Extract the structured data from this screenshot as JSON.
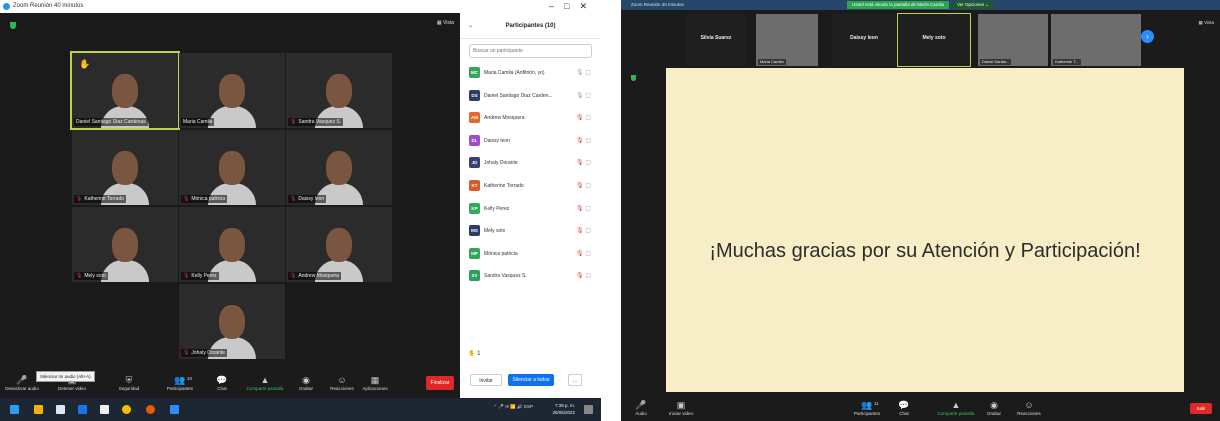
{
  "left": {
    "window_title": "Zoom Reunión 40 minutos",
    "window_controls": [
      "–",
      "□",
      "✕"
    ],
    "view_label": "Vista",
    "tiles": [
      {
        "name": "Daniel Santiago Diaz Cardenas",
        "muted": false,
        "hand": true,
        "active": true
      },
      {
        "name": "Maria Camila",
        "muted": false,
        "hand": false,
        "active": false
      },
      {
        "name": "Sandra Vasquez S.",
        "muted": true,
        "hand": false,
        "active": false
      },
      {
        "name": "Katherine Torrado",
        "muted": true,
        "hand": false,
        "active": false
      },
      {
        "name": "Mónica patricia",
        "muted": true,
        "hand": false,
        "active": false
      },
      {
        "name": "Daissy leon",
        "muted": true,
        "hand": false,
        "active": false
      },
      {
        "name": "Mely soto",
        "muted": true,
        "hand": false,
        "active": false
      },
      {
        "name": "Kelly Perez",
        "muted": true,
        "hand": false,
        "active": false
      },
      {
        "name": "Andrew Mosquera",
        "muted": true,
        "hand": false,
        "active": false
      },
      {
        "name": "Johaly Dorante",
        "muted": true,
        "hand": false,
        "active": false
      }
    ],
    "tooltip": "Silenciar mi audio (Alt+A)",
    "toolbar": [
      {
        "label": "Desactivar audio",
        "icon": "🎤"
      },
      {
        "label": "Detener video",
        "icon": "▣"
      },
      {
        "label": "Seguridad",
        "icon": "⛨"
      },
      {
        "label": "Participantes",
        "icon": "👥",
        "count": "10"
      },
      {
        "label": "Chat",
        "icon": "💬"
      },
      {
        "label": "Compartir pantalla",
        "icon": "▲"
      },
      {
        "label": "Grabar",
        "icon": "◉"
      },
      {
        "label": "Reacciones",
        "icon": "☺"
      },
      {
        "label": "Aplicaciones",
        "icon": "▦"
      }
    ],
    "end_label": "Finalizar",
    "panel": {
      "title": "Participantes (10)",
      "search_placeholder": "Buscar un participante",
      "participants": [
        {
          "initials": "MC",
          "name": "Maria Camila (Anfitrión, yo)",
          "color": "#3aa35b",
          "muted": false
        },
        {
          "initials": "DS",
          "name": "Daniel Santiago Diaz Carden...",
          "color": "#2c3e63",
          "muted": false
        },
        {
          "initials": "AM",
          "name": "Andrew Mosquera",
          "color": "#e0692b",
          "muted": true
        },
        {
          "initials": "DL",
          "name": "Daissy leon",
          "color": "#9a4fc8",
          "muted": true
        },
        {
          "initials": "JD",
          "name": "Johaly Dorante",
          "color": "#3a3f73",
          "muted": true
        },
        {
          "initials": "KT",
          "name": "Katherine Torrado",
          "color": "#d65a2a",
          "muted": true
        },
        {
          "initials": "KP",
          "name": "Kelly Perez",
          "color": "#36a85a",
          "muted": true
        },
        {
          "initials": "MS",
          "name": "Mely soto",
          "color": "#2f3b66",
          "muted": true
        },
        {
          "initials": "MP",
          "name": "Mónica patricia",
          "color": "#3aa35b",
          "muted": true
        },
        {
          "initials": "SV",
          "name": "Sandra Vasquez S.",
          "color": "#2e9b5f",
          "muted": true
        }
      ],
      "hands_count": "1",
      "invite_label": "Invitar",
      "mute_all_label": "Silenciar a todos",
      "more_label": "..."
    },
    "tray_text": "ESP",
    "clock_time": "7:39 p. m.",
    "clock_date": "28/05/2022"
  },
  "right": {
    "window_title": "Zoom Reunión 40 minutos",
    "share_banner": "Usted está viendo la pantalla de María Camila",
    "view_options": "Ver Opciones",
    "view_label": "Vista",
    "strip": [
      {
        "name": "Silvia Suarez",
        "video": false
      },
      {
        "name": "Maria Camila",
        "video": true
      },
      {
        "name": "Daissy leon",
        "video": false
      },
      {
        "name": "Mely soto",
        "video": false,
        "active": true
      },
      {
        "name": "Daniel Santia...",
        "video": true
      },
      {
        "name": "Katherine T...",
        "video": true
      }
    ],
    "slide_text": "¡Muchas gracias  por su Atención y Participación!",
    "toolbar": [
      {
        "label": "Audio",
        "icon": "🎤"
      },
      {
        "label": "Iniciar video",
        "icon": "▣"
      },
      {
        "label": "Participantes",
        "icon": "👥",
        "count": "11"
      },
      {
        "label": "Chat",
        "icon": "💬"
      },
      {
        "label": "Compartir pantalla",
        "icon": "▲"
      },
      {
        "label": "Grabar",
        "icon": "◉"
      },
      {
        "label": "Reacciones",
        "icon": "☺"
      }
    ],
    "leave_label": "Salir"
  }
}
